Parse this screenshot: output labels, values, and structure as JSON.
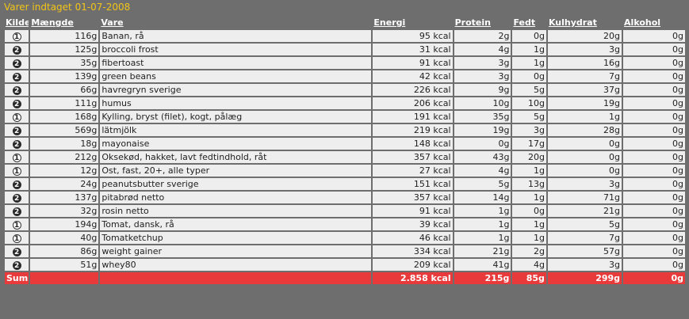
{
  "title": "Varer indtaget 01-07-2008",
  "colors": {
    "title_text": "#f2c418",
    "background": "#6e6e6e",
    "row_bg": "#eeeeee",
    "sum_bg": "#e83a3a"
  },
  "columns": {
    "source": "Kilde",
    "amount": "Mængde",
    "item": "Vare",
    "energy": "Energi",
    "protein": "Protein",
    "fat": "Fedt",
    "carbs": "Kulhydrat",
    "alcohol": "Alkohol"
  },
  "rows": [
    {
      "source": "1",
      "amount": "116g",
      "item": "Banan, rå",
      "energy": "95 kcal",
      "protein": "2g",
      "fat": "0g",
      "carbs": "20g",
      "alcohol": "0g"
    },
    {
      "source": "2",
      "amount": "125g",
      "item": "broccoli frost",
      "energy": "31 kcal",
      "protein": "4g",
      "fat": "1g",
      "carbs": "3g",
      "alcohol": "0g"
    },
    {
      "source": "2",
      "amount": "35g",
      "item": "fibertoast",
      "energy": "91 kcal",
      "protein": "3g",
      "fat": "1g",
      "carbs": "16g",
      "alcohol": "0g"
    },
    {
      "source": "2",
      "amount": "139g",
      "item": "green beans",
      "energy": "42 kcal",
      "protein": "3g",
      "fat": "0g",
      "carbs": "7g",
      "alcohol": "0g"
    },
    {
      "source": "2",
      "amount": "66g",
      "item": "havregryn sverige",
      "energy": "226 kcal",
      "protein": "9g",
      "fat": "5g",
      "carbs": "37g",
      "alcohol": "0g"
    },
    {
      "source": "2",
      "amount": "111g",
      "item": "humus",
      "energy": "206 kcal",
      "protein": "10g",
      "fat": "10g",
      "carbs": "19g",
      "alcohol": "0g"
    },
    {
      "source": "1",
      "amount": "168g",
      "item": "Kylling, bryst (filet), kogt, pålæg",
      "energy": "191 kcal",
      "protein": "35g",
      "fat": "5g",
      "carbs": "1g",
      "alcohol": "0g"
    },
    {
      "source": "2",
      "amount": "569g",
      "item": "lätmjölk",
      "energy": "219 kcal",
      "protein": "19g",
      "fat": "3g",
      "carbs": "28g",
      "alcohol": "0g"
    },
    {
      "source": "2",
      "amount": "18g",
      "item": "mayonaise",
      "energy": "148 kcal",
      "protein": "0g",
      "fat": "17g",
      "carbs": "0g",
      "alcohol": "0g"
    },
    {
      "source": "1",
      "amount": "212g",
      "item": "Oksekød, hakket, lavt fedtindhold, råt",
      "energy": "357 kcal",
      "protein": "43g",
      "fat": "20g",
      "carbs": "0g",
      "alcohol": "0g"
    },
    {
      "source": "1",
      "amount": "12g",
      "item": "Ost, fast, 20+, alle typer",
      "energy": "27 kcal",
      "protein": "4g",
      "fat": "1g",
      "carbs": "0g",
      "alcohol": "0g"
    },
    {
      "source": "2",
      "amount": "24g",
      "item": "peanutsbutter sverige",
      "energy": "151 kcal",
      "protein": "5g",
      "fat": "13g",
      "carbs": "3g",
      "alcohol": "0g"
    },
    {
      "source": "2",
      "amount": "137g",
      "item": "pitabrød netto",
      "energy": "357 kcal",
      "protein": "14g",
      "fat": "1g",
      "carbs": "71g",
      "alcohol": "0g"
    },
    {
      "source": "2",
      "amount": "32g",
      "item": "rosin netto",
      "energy": "91 kcal",
      "protein": "1g",
      "fat": "0g",
      "carbs": "21g",
      "alcohol": "0g"
    },
    {
      "source": "1",
      "amount": "194g",
      "item": "Tomat, dansk, rå",
      "energy": "39 kcal",
      "protein": "1g",
      "fat": "1g",
      "carbs": "5g",
      "alcohol": "0g"
    },
    {
      "source": "1",
      "amount": "40g",
      "item": "Tomatketchup",
      "energy": "46 kcal",
      "protein": "1g",
      "fat": "1g",
      "carbs": "7g",
      "alcohol": "0g"
    },
    {
      "source": "2",
      "amount": "86g",
      "item": "weight gainer",
      "energy": "334 kcal",
      "protein": "21g",
      "fat": "2g",
      "carbs": "57g",
      "alcohol": "0g"
    },
    {
      "source": "2",
      "amount": "51g",
      "item": "whey80",
      "energy": "209 kcal",
      "protein": "41g",
      "fat": "4g",
      "carbs": "3g",
      "alcohol": "0g"
    }
  ],
  "sum": {
    "label": "Sum",
    "energy": "2.858 kcal",
    "protein": "215g",
    "fat": "85g",
    "carbs": "299g",
    "alcohol": "0g"
  }
}
